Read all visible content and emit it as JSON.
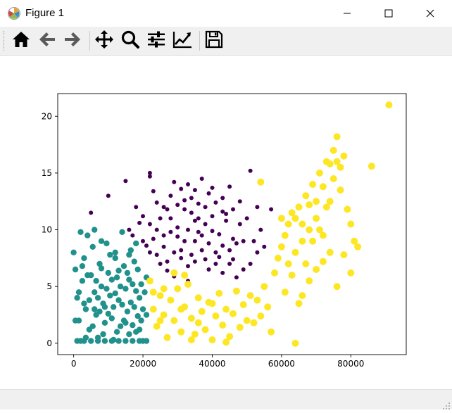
{
  "window": {
    "title": "Figure 1",
    "controls": [
      "minimize",
      "maximize",
      "close"
    ]
  },
  "toolbar": {
    "buttons": [
      {
        "name": "home",
        "icon": "home-icon"
      },
      {
        "name": "back",
        "icon": "arrow-left-icon"
      },
      {
        "name": "forward",
        "icon": "arrow-right-icon"
      },
      {
        "name": "pan",
        "icon": "move-icon"
      },
      {
        "name": "zoom",
        "icon": "magnifier-icon"
      },
      {
        "name": "configure-subplots",
        "icon": "sliders-icon"
      },
      {
        "name": "edit-axis",
        "icon": "line-chart-icon"
      },
      {
        "name": "save",
        "icon": "floppy-disk-icon"
      }
    ]
  },
  "chart_data": {
    "type": "scatter",
    "title": "",
    "xlabel": "",
    "ylabel": "",
    "xlim": [
      -4600,
      96000
    ],
    "ylim": [
      -1.0,
      22.0
    ],
    "x_ticks": [
      0,
      20000,
      40000,
      60000,
      80000
    ],
    "x_tick_labels": [
      "0",
      "20000",
      "40000",
      "60000",
      "80000"
    ],
    "y_ticks": [
      0,
      5,
      10,
      15,
      20
    ],
    "y_tick_labels": [
      "0",
      "5",
      "10",
      "15",
      "20"
    ],
    "grid": false,
    "legend": "none",
    "series": [
      {
        "color": "#440154",
        "marker_size": "small",
        "points": [
          [
            5000,
            11.5
          ],
          [
            10000,
            13.0
          ],
          [
            15000,
            14.3
          ],
          [
            22000,
            15.0
          ],
          [
            22000,
            14.7
          ],
          [
            29000,
            14.2
          ],
          [
            23000,
            13.4
          ],
          [
            28000,
            13.0
          ],
          [
            33000,
            14.0
          ],
          [
            37000,
            14.5
          ],
          [
            40000,
            13.7
          ],
          [
            45000,
            13.8
          ],
          [
            51000,
            15.2
          ],
          [
            53000,
            12.0
          ],
          [
            57000,
            11.8
          ],
          [
            18000,
            12.0
          ],
          [
            20000,
            11.2
          ],
          [
            22000,
            10.5
          ],
          [
            24000,
            10.0
          ],
          [
            26000,
            9.5
          ],
          [
            28000,
            11.0
          ],
          [
            30000,
            10.2
          ],
          [
            32000,
            9.0
          ],
          [
            34000,
            11.5
          ],
          [
            35000,
            10.8
          ],
          [
            36000,
            9.8
          ],
          [
            38000,
            10.5
          ],
          [
            40000,
            11.2
          ],
          [
            42000,
            9.6
          ],
          [
            44000,
            10.8
          ],
          [
            46000,
            9.2
          ],
          [
            48000,
            10.5
          ],
          [
            50000,
            11.0
          ],
          [
            52000,
            9.0
          ],
          [
            54000,
            10.0
          ],
          [
            55000,
            8.5
          ],
          [
            16000,
            10.0
          ],
          [
            17000,
            9.5
          ],
          [
            20000,
            9.0
          ],
          [
            22000,
            8.0
          ],
          [
            24000,
            7.8
          ],
          [
            26000,
            8.5
          ],
          [
            27000,
            7.2
          ],
          [
            29000,
            8.0
          ],
          [
            31000,
            7.5
          ],
          [
            33000,
            6.8
          ],
          [
            35000,
            7.2
          ],
          [
            37000,
            8.2
          ],
          [
            39000,
            6.5
          ],
          [
            41000,
            7.0
          ],
          [
            43000,
            6.2
          ],
          [
            45000,
            7.0
          ],
          [
            47000,
            5.8
          ],
          [
            49000,
            6.5
          ],
          [
            51000,
            7.0
          ],
          [
            53000,
            8.0
          ],
          [
            30000,
            12.2
          ],
          [
            32000,
            12.6
          ],
          [
            34000,
            12.8
          ],
          [
            36000,
            12.3
          ],
          [
            38000,
            12.0
          ],
          [
            41000,
            12.4
          ],
          [
            43000,
            11.6
          ],
          [
            46000,
            11.8
          ],
          [
            48000,
            12.5
          ],
          [
            27000,
            11.8
          ],
          [
            25000,
            11.0
          ],
          [
            23000,
            9.2
          ],
          [
            21000,
            8.6
          ],
          [
            19000,
            10.6
          ],
          [
            30000,
            9.4
          ],
          [
            33000,
            10.0
          ],
          [
            35000,
            9.0
          ],
          [
            37000,
            9.5
          ],
          [
            39000,
            8.8
          ],
          [
            41000,
            8.0
          ],
          [
            43000,
            8.6
          ],
          [
            45000,
            8.2
          ],
          [
            47000,
            8.8
          ],
          [
            49000,
            9.0
          ],
          [
            28000,
            9.8
          ],
          [
            32000,
            11.8
          ],
          [
            36000,
            11.0
          ],
          [
            40000,
            9.9
          ],
          [
            44000,
            11.4
          ],
          [
            31000,
            8.2
          ],
          [
            34000,
            7.8
          ],
          [
            38000,
            7.4
          ],
          [
            42000,
            7.6
          ],
          [
            46000,
            7.4
          ],
          [
            26000,
            12.0
          ],
          [
            24000,
            12.4
          ],
          [
            39000,
            13.2
          ],
          [
            43000,
            12.8
          ],
          [
            35000,
            13.5
          ],
          [
            31000,
            13.6
          ],
          [
            27000,
            6.4
          ],
          [
            33000,
            5.5
          ],
          [
            29000,
            5.9
          ],
          [
            25000,
            7.0
          ]
        ]
      },
      {
        "color": "#21918c",
        "marker_size": "medium",
        "points": [
          [
            0,
            8.0
          ],
          [
            500,
            6.5
          ],
          [
            1000,
            4.0
          ],
          [
            1500,
            2.0
          ],
          [
            2000,
            0.2
          ],
          [
            2500,
            5.5
          ],
          [
            3000,
            7.5
          ],
          [
            3500,
            3.0
          ],
          [
            4000,
            9.5
          ],
          [
            4500,
            1.2
          ],
          [
            5000,
            6.0
          ],
          [
            5500,
            8.5
          ],
          [
            6000,
            4.5
          ],
          [
            6500,
            2.5
          ],
          [
            7000,
            0.5
          ],
          [
            7500,
            7.0
          ],
          [
            8000,
            5.0
          ],
          [
            8500,
            3.5
          ],
          [
            9000,
            1.8
          ],
          [
            9500,
            8.8
          ],
          [
            10000,
            6.2
          ],
          [
            10500,
            4.2
          ],
          [
            11000,
            2.2
          ],
          [
            11500,
            0.3
          ],
          [
            12000,
            7.5
          ],
          [
            12500,
            5.8
          ],
          [
            13000,
            3.8
          ],
          [
            13500,
            1.5
          ],
          [
            14000,
            9.8
          ],
          [
            14500,
            6.8
          ],
          [
            15000,
            4.8
          ],
          [
            15500,
            2.8
          ],
          [
            16000,
            0.8
          ],
          [
            16500,
            8.2
          ],
          [
            17000,
            5.2
          ],
          [
            17500,
            3.2
          ],
          [
            18000,
            1.0
          ],
          [
            18500,
            6.5
          ],
          [
            19000,
            4.0
          ],
          [
            19500,
            2.0
          ],
          [
            20000,
            0.2
          ],
          [
            20500,
            4.5
          ],
          [
            21000,
            2.5
          ],
          [
            500,
            2.0
          ],
          [
            1500,
            4.5
          ],
          [
            2500,
            6.8
          ],
          [
            3500,
            0.5
          ],
          [
            4500,
            3.8
          ],
          [
            5500,
            1.5
          ],
          [
            6500,
            5.5
          ],
          [
            7500,
            2.8
          ],
          [
            8500,
            0.8
          ],
          [
            9500,
            4.8
          ],
          [
            10500,
            7.8
          ],
          [
            11500,
            3.2
          ],
          [
            12500,
            1.0
          ],
          [
            13500,
            5.0
          ],
          [
            14500,
            2.0
          ],
          [
            15500,
            6.2
          ],
          [
            16500,
            3.6
          ],
          [
            17500,
            7.2
          ],
          [
            18500,
            2.4
          ],
          [
            19500,
            5.2
          ],
          [
            1000,
            0.2
          ],
          [
            3000,
            0.2
          ],
          [
            5000,
            0.2
          ],
          [
            7000,
            0.2
          ],
          [
            9000,
            0.2
          ],
          [
            11000,
            0.2
          ],
          [
            13000,
            0.2
          ],
          [
            15000,
            0.2
          ],
          [
            17000,
            0.2
          ],
          [
            19000,
            0.2
          ],
          [
            21000,
            0.2
          ],
          [
            2000,
            9.8
          ],
          [
            6000,
            10.0
          ],
          [
            8000,
            9.0
          ],
          [
            12000,
            8.0
          ],
          [
            16000,
            7.8
          ],
          [
            18000,
            8.8
          ],
          [
            4000,
            6.0
          ],
          [
            6000,
            3.0
          ],
          [
            8000,
            6.6
          ],
          [
            10000,
            2.6
          ],
          [
            12000,
            4.4
          ],
          [
            14000,
            3.4
          ],
          [
            16000,
            5.6
          ],
          [
            18000,
            4.6
          ],
          [
            20000,
            3.0
          ],
          [
            21000,
            5.8
          ],
          [
            3000,
            3.5
          ],
          [
            7000,
            4.0
          ],
          [
            11000,
            5.6
          ],
          [
            15000,
            1.8
          ],
          [
            19000,
            1.2
          ],
          [
            9000,
            3.2
          ],
          [
            13000,
            6.4
          ],
          [
            17000,
            1.6
          ]
        ]
      },
      {
        "color": "#fde725",
        "marker_size": "large",
        "points": [
          [
            22000,
            5.5
          ],
          [
            23000,
            3.0
          ],
          [
            24000,
            1.5
          ],
          [
            25000,
            4.2
          ],
          [
            26000,
            2.5
          ],
          [
            27000,
            0.5
          ],
          [
            28000,
            3.8
          ],
          [
            29000,
            2.0
          ],
          [
            30000,
            4.8
          ],
          [
            31000,
            1.0
          ],
          [
            32000,
            3.2
          ],
          [
            33000,
            5.2
          ],
          [
            34000,
            2.2
          ],
          [
            35000,
            0.8
          ],
          [
            36000,
            4.0
          ],
          [
            37000,
            2.8
          ],
          [
            38000,
            1.2
          ],
          [
            39000,
            3.6
          ],
          [
            40000,
            0.3
          ],
          [
            41000,
            2.4
          ],
          [
            42000,
            4.4
          ],
          [
            43000,
            1.6
          ],
          [
            44000,
            3.0
          ],
          [
            45000,
            0.6
          ],
          [
            46000,
            2.6
          ],
          [
            47000,
            4.6
          ],
          [
            48000,
            1.4
          ],
          [
            49000,
            3.4
          ],
          [
            50000,
            2.0
          ],
          [
            51000,
            4.2
          ],
          [
            52000,
            1.8
          ],
          [
            53000,
            3.8
          ],
          [
            54000,
            2.4
          ],
          [
            55000,
            5.0
          ],
          [
            56000,
            3.2
          ],
          [
            57000,
            1.0
          ],
          [
            58000,
            6.2
          ],
          [
            59000,
            7.5
          ],
          [
            60000,
            8.5
          ],
          [
            61000,
            9.5
          ],
          [
            62000,
            10.5
          ],
          [
            63000,
            11.5
          ],
          [
            64000,
            8.0
          ],
          [
            65000,
            12.0
          ],
          [
            66000,
            9.0
          ],
          [
            67000,
            13.0
          ],
          [
            68000,
            10.0
          ],
          [
            69000,
            14.0
          ],
          [
            70000,
            11.0
          ],
          [
            71000,
            15.0
          ],
          [
            72000,
            9.5
          ],
          [
            73000,
            16.0
          ],
          [
            74000,
            12.5
          ],
          [
            75000,
            17.0
          ],
          [
            76000,
            18.2
          ],
          [
            77000,
            13.5
          ],
          [
            78000,
            16.5
          ],
          [
            79000,
            11.8
          ],
          [
            80000,
            10.5
          ],
          [
            81000,
            9.0
          ],
          [
            82000,
            8.5
          ],
          [
            86000,
            15.6
          ],
          [
            91000,
            21.0
          ],
          [
            54000,
            14.2
          ],
          [
            60000,
            11.0
          ],
          [
            62000,
            7.0
          ],
          [
            64000,
            0.0
          ],
          [
            66000,
            4.2
          ],
          [
            68000,
            5.5
          ],
          [
            70000,
            6.5
          ],
          [
            72000,
            7.2
          ],
          [
            74000,
            8.0
          ],
          [
            76000,
            5.0
          ],
          [
            78000,
            7.8
          ],
          [
            80000,
            6.2
          ],
          [
            61000,
            4.5
          ],
          [
            63000,
            6.0
          ],
          [
            65000,
            3.5
          ],
          [
            67000,
            7.0
          ],
          [
            69000,
            9.0
          ],
          [
            71000,
            10.0
          ],
          [
            73000,
            12.0
          ],
          [
            75000,
            14.5
          ],
          [
            77000,
            15.5
          ],
          [
            70000,
            12.5
          ],
          [
            68000,
            12.2
          ],
          [
            66000,
            10.5
          ],
          [
            64000,
            11.0
          ],
          [
            72000,
            13.8
          ],
          [
            74000,
            15.8
          ],
          [
            76000,
            16.0
          ],
          [
            34000,
            0.3
          ],
          [
            44000,
            0.1
          ],
          [
            32000,
            6.0
          ],
          [
            29000,
            6.2
          ],
          [
            26000,
            4.8
          ],
          [
            23000,
            4.5
          ],
          [
            25000,
            2.0
          ],
          [
            31000,
            3.0
          ],
          [
            36000,
            1.8
          ],
          [
            40000,
            3.5
          ]
        ]
      }
    ]
  }
}
